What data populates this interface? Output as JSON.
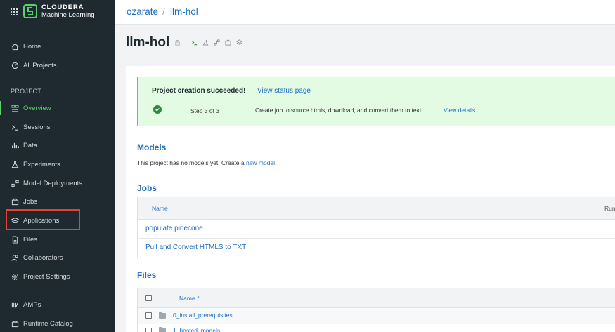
{
  "brand": {
    "name": "CLOUDERA",
    "product": "Machine Learning"
  },
  "breadcrumb": {
    "user": "ozarate",
    "separator": "/",
    "project": "llm-hol"
  },
  "sidebar": {
    "top_items": [
      {
        "label": "Home",
        "icon": "home-icon"
      },
      {
        "label": "All Projects",
        "icon": "gauge-icon"
      }
    ],
    "section_label": "PROJECT",
    "project_items": [
      {
        "label": "Overview",
        "icon": "overview-icon",
        "active": true
      },
      {
        "label": "Sessions",
        "icon": "terminal-icon"
      },
      {
        "label": "Data",
        "icon": "bar-chart-icon"
      },
      {
        "label": "Experiments",
        "icon": "flask-icon"
      },
      {
        "label": "Model Deployments",
        "icon": "deployments-icon"
      },
      {
        "label": "Jobs",
        "icon": "jobs-icon"
      },
      {
        "label": "Applications",
        "icon": "layers-icon",
        "highlighted": true
      },
      {
        "label": "Files",
        "icon": "file-icon"
      },
      {
        "label": "Collaborators",
        "icon": "users-icon"
      },
      {
        "label": "Project Settings",
        "icon": "gear-icon"
      }
    ],
    "bottom_items": [
      {
        "label": "AMPs",
        "icon": "amps-icon"
      },
      {
        "label": "Runtime Catalog",
        "icon": "catalog-icon"
      }
    ]
  },
  "page": {
    "title": "llm-hol"
  },
  "success_banner": {
    "title": "Project creation succeeded!",
    "link": "View status page",
    "step": "Step 3 of 3",
    "description": "Create job to source htmls, download, and convert them to text.",
    "details_link": "View details"
  },
  "models": {
    "heading": "Models",
    "text": "This project has no models yet. Create a ",
    "link": "new model",
    "suffix": "."
  },
  "jobs": {
    "heading": "Jobs",
    "columns": [
      "Name",
      "Run"
    ],
    "rows": [
      "populate pinecone",
      "Pull and Convert HTMLS to TXT"
    ]
  },
  "files": {
    "heading": "Files",
    "column": "Name ^",
    "rows": [
      "0_install_prerequisites",
      "1_hosted_models"
    ]
  },
  "colors": {
    "accent": "#1f6ec0",
    "sidebar": "#1f2a30",
    "active": "#5bd16b",
    "highlight": "#e8412f",
    "success_bg": "#e3fbe3"
  }
}
